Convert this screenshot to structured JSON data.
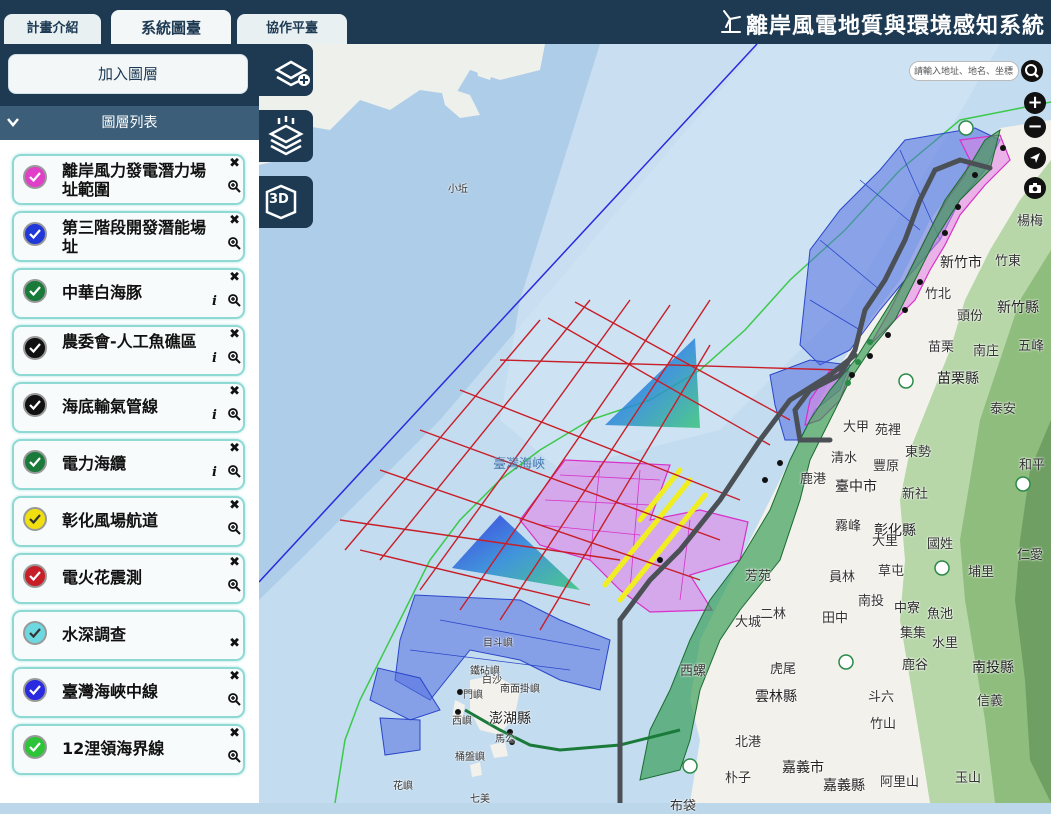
{
  "header": {
    "tabs": [
      {
        "label": "計畫介紹"
      },
      {
        "label": "系統圖臺"
      },
      {
        "label": "協作平臺"
      }
    ],
    "title": "離岸風電地質與環境感知系統",
    "logo_icon": "wind-turbine-icon"
  },
  "panel": {
    "add_layer_label": "加入圖層",
    "list_title": "圖層列表",
    "layers": [
      {
        "name": "離岸風力發電潛力場址範圍",
        "color": "#e040c8",
        "info": false
      },
      {
        "name": "第三階段開發潛能場址",
        "color": "#2038d8",
        "info": false
      },
      {
        "name": "中華白海豚",
        "color": "#1a7a3a",
        "info": true
      },
      {
        "name": "農委會-人工魚礁區",
        "color": "#111111",
        "info": true
      },
      {
        "name": "海底輸氣管線",
        "color": "#111111",
        "info": true
      },
      {
        "name": "電力海纜",
        "color": "#1a7a3a",
        "info": true
      },
      {
        "name": "彰化風場航道",
        "color": "#f0e010",
        "info": false
      },
      {
        "name": "電火花震測",
        "color": "#c81e28",
        "info": false
      },
      {
        "name": "水深調查",
        "color": "#6ed8e0",
        "info": false
      },
      {
        "name": "臺灣海峽中線",
        "color": "#2a2ae0",
        "info": false
      },
      {
        "name": "12浬領海界線",
        "color": "#2ec43a",
        "info": false
      }
    ]
  },
  "tools": {
    "add_layer_icon": "layers-add-icon",
    "layer_stack_icon": "layer-stack-icon",
    "view_3d_label": "3D"
  },
  "search": {
    "placeholder": "請輸入地址、地名、坐標"
  },
  "map_controls": {
    "zoom_in": "+",
    "zoom_out": "−"
  },
  "map_labels": {
    "sea": "臺灣海峽",
    "xiaotai": "小坵",
    "penghu": "澎湖縣",
    "places": [
      {
        "text": "新竹市",
        "cls": "big"
      },
      {
        "text": "竹北",
        "cls": ""
      },
      {
        "text": "竹東",
        "cls": ""
      },
      {
        "text": "新竹縣",
        "cls": "big"
      },
      {
        "text": "頭份",
        "cls": ""
      },
      {
        "text": "苗栗",
        "cls": ""
      },
      {
        "text": "南庄",
        "cls": ""
      },
      {
        "text": "五峰",
        "cls": ""
      },
      {
        "text": "苗栗縣",
        "cls": "big"
      },
      {
        "text": "泰安",
        "cls": ""
      },
      {
        "text": "大甲",
        "cls": ""
      },
      {
        "text": "苑裡",
        "cls": ""
      },
      {
        "text": "東勢",
        "cls": ""
      },
      {
        "text": "清水",
        "cls": ""
      },
      {
        "text": "豐原",
        "cls": ""
      },
      {
        "text": "和平",
        "cls": ""
      },
      {
        "text": "臺中市",
        "cls": "big"
      },
      {
        "text": "新社",
        "cls": ""
      },
      {
        "text": "霧峰",
        "cls": ""
      },
      {
        "text": "彰化縣",
        "cls": "big"
      },
      {
        "text": "大里",
        "cls": ""
      },
      {
        "text": "國姓",
        "cls": ""
      },
      {
        "text": "仁愛",
        "cls": ""
      },
      {
        "text": "員林",
        "cls": ""
      },
      {
        "text": "草屯",
        "cls": ""
      },
      {
        "text": "埔里",
        "cls": ""
      },
      {
        "text": "南投",
        "cls": ""
      },
      {
        "text": "中寮",
        "cls": ""
      },
      {
        "text": "魚池",
        "cls": ""
      },
      {
        "text": "二林",
        "cls": ""
      },
      {
        "text": "田中",
        "cls": ""
      },
      {
        "text": "集集",
        "cls": ""
      },
      {
        "text": "水里",
        "cls": ""
      },
      {
        "text": "信義",
        "cls": ""
      },
      {
        "text": "南投縣",
        "cls": "big"
      },
      {
        "text": "鹿谷",
        "cls": ""
      },
      {
        "text": "虎尾",
        "cls": ""
      },
      {
        "text": "雲林縣",
        "cls": "big"
      },
      {
        "text": "斗六",
        "cls": ""
      },
      {
        "text": "竹山",
        "cls": ""
      },
      {
        "text": "北港",
        "cls": ""
      },
      {
        "text": "朴子",
        "cls": ""
      },
      {
        "text": "嘉義市",
        "cls": "big"
      },
      {
        "text": "嘉義縣",
        "cls": "big"
      },
      {
        "text": "阿里山",
        "cls": ""
      },
      {
        "text": "玉山",
        "cls": ""
      },
      {
        "text": "布袋",
        "cls": ""
      },
      {
        "text": "芳苑",
        "cls": ""
      },
      {
        "text": "大城",
        "cls": ""
      },
      {
        "text": "西螺",
        "cls": ""
      },
      {
        "text": "楊梅",
        "cls": ""
      },
      {
        "text": "鹿港",
        "cls": ""
      }
    ],
    "islands": [
      {
        "text": "目斗嶼"
      },
      {
        "text": "鐵砧嶼"
      },
      {
        "text": "南面掛嶼"
      },
      {
        "text": "白沙"
      },
      {
        "text": "七美"
      },
      {
        "text": "門嶼"
      },
      {
        "text": "花嶼"
      },
      {
        "text": "西嶼"
      },
      {
        "text": "馬公"
      },
      {
        "text": "桶盤嶼"
      }
    ]
  }
}
